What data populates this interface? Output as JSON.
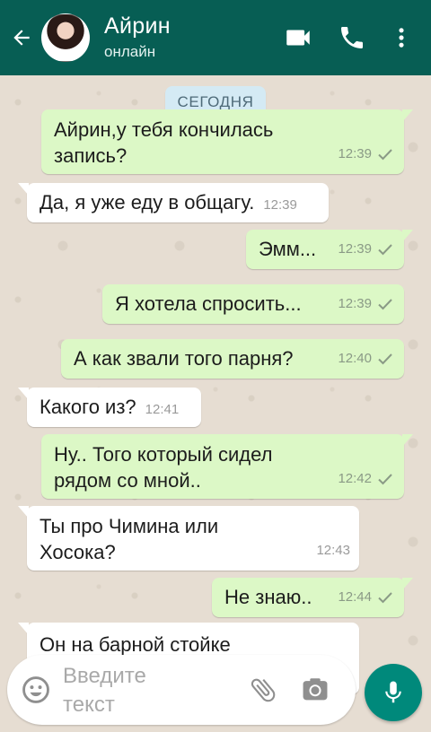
{
  "header": {
    "contact_name": "Айрин",
    "status": "онлайн",
    "colors": {
      "bar": "#075e54",
      "text": "#ffffff"
    },
    "icons": [
      "back-arrow-icon",
      "video-call-icon",
      "phone-icon",
      "more-vert-icon"
    ]
  },
  "chat": {
    "date_chip": "СЕГОДНЯ",
    "messages": [
      {
        "direction": "out",
        "text": "Айрин,у тебя кончилась\nзапись?",
        "time": "12:39",
        "status": "read"
      },
      {
        "direction": "in",
        "text": "Да, я уже еду в общагу.",
        "time": "12:39"
      },
      {
        "direction": "out",
        "text": "Эмм...",
        "time": "12:39",
        "status": "read"
      },
      {
        "direction": "out",
        "text": "Я хотела спросить...",
        "time": "12:39",
        "status": "read"
      },
      {
        "direction": "out",
        "text": "А как звали того парня?",
        "time": "12:40",
        "status": "read"
      },
      {
        "direction": "in",
        "text": "Какого из?",
        "time": "12:41"
      },
      {
        "direction": "out",
        "text": "Ну.. Того который сидел\nрядом со мной..",
        "time": "12:42",
        "status": "read"
      },
      {
        "direction": "in",
        "text": "Ты про Чимина или\nХосока?",
        "time": "12:43"
      },
      {
        "direction": "out",
        "text": "Не знаю..",
        "time": "12:44",
        "status": "read"
      },
      {
        "direction": "in",
        "text": "Он на барной стойке",
        "time": ""
      }
    ],
    "colors": {
      "outgoing": "#dcf8c6",
      "incoming": "#ffffff",
      "check": "#8a9a86"
    }
  },
  "composer": {
    "placeholder": "Введите\nтекст",
    "icons": [
      "emoji-icon",
      "attach-icon",
      "camera-icon",
      "mic-icon"
    ],
    "colors": {
      "mic_button": "#00897b",
      "icon": "#8f8f8f"
    }
  }
}
